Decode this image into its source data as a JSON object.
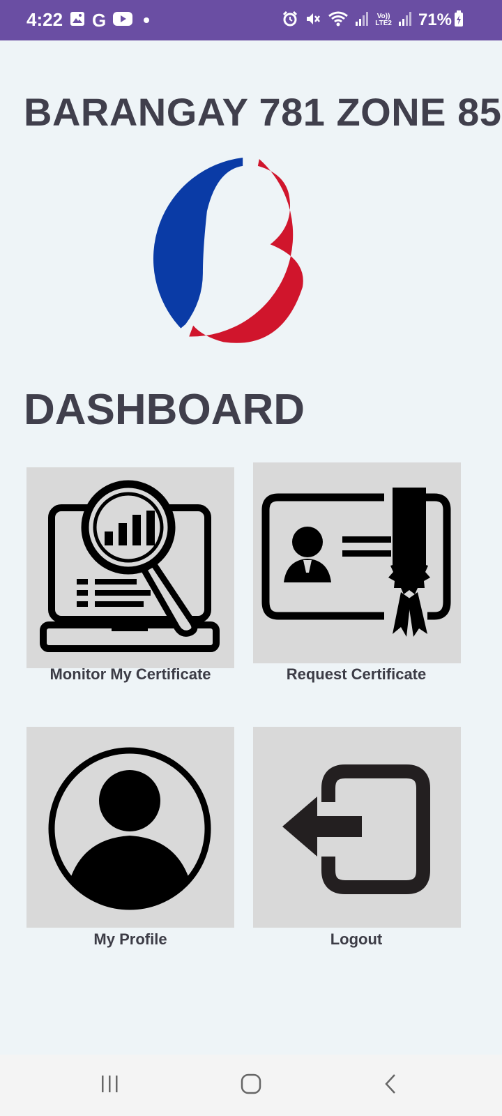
{
  "status_bar": {
    "time": "4:22",
    "battery": "71%",
    "lte_top": "Vo))",
    "lte_bottom": "LTE2",
    "icons": [
      "gallery-icon",
      "google-icon",
      "youtube-icon",
      "dot-icon",
      "alarm-icon",
      "mute-icon",
      "wifi-icon",
      "signal-icon",
      "battery-icon"
    ],
    "bar_color": "#6a4ea3"
  },
  "header": {
    "title": "BARANGAY 781 ZONE 85"
  },
  "logo": {
    "colors": {
      "blue": "#0a3ba6",
      "red": "#d0152c"
    }
  },
  "dashboard": {
    "title": "DASHBOARD",
    "tiles": [
      {
        "label": "Monitor My Certificate",
        "icon": "monitor-certificate-icon"
      },
      {
        "label": "Request Certificate",
        "icon": "certificate-icon"
      },
      {
        "label": "My Profile",
        "icon": "profile-icon"
      },
      {
        "label": "Logout",
        "icon": "logout-icon"
      }
    ]
  },
  "nav_bar": {
    "buttons": [
      "recent-apps-icon",
      "home-icon",
      "back-icon"
    ]
  }
}
